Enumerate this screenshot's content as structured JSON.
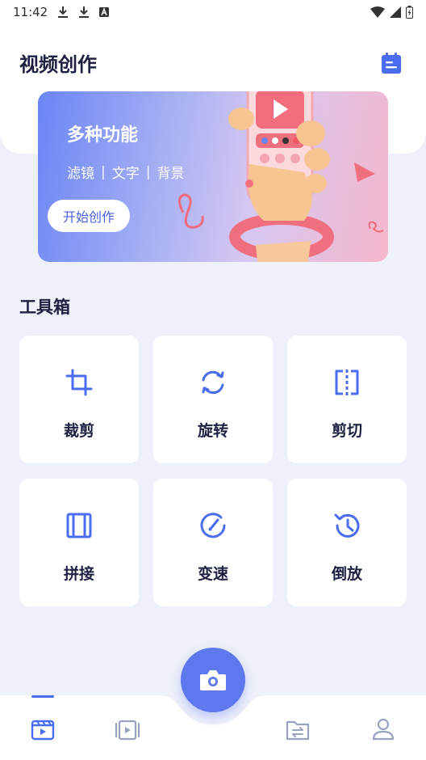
{
  "status_bar": {
    "time": "11:42",
    "left_icons": [
      "download-icon",
      "download-icon",
      "notification-a-icon"
    ],
    "right_icons": [
      "wifi-icon",
      "signal-icon",
      "battery-icon"
    ]
  },
  "header": {
    "title": "视频创作",
    "action_icon": "calendar-icon"
  },
  "banner": {
    "title": "多种功能",
    "features": [
      "滤镜",
      "文字",
      "背景"
    ],
    "separator": "|",
    "cta": "开始创作"
  },
  "toolbox": {
    "title": "工具箱",
    "tools": [
      {
        "label": "裁剪",
        "icon": "crop-icon"
      },
      {
        "label": "旋转",
        "icon": "rotate-icon"
      },
      {
        "label": "剪切",
        "icon": "split-icon"
      },
      {
        "label": "拼接",
        "icon": "merge-icon"
      },
      {
        "label": "变速",
        "icon": "speed-icon"
      },
      {
        "label": "倒放",
        "icon": "reverse-icon"
      }
    ]
  },
  "tabbar": {
    "items": [
      "video-create-tab-icon",
      "video-list-tab-icon",
      "file-transfer-tab-icon",
      "profile-tab-icon"
    ],
    "active_index": 0,
    "fab_icon": "camera-icon"
  },
  "colors": {
    "accent": "#4a6cf0",
    "fab": "#5e79ef",
    "background": "#eef1fa",
    "text": "#1d2040"
  }
}
